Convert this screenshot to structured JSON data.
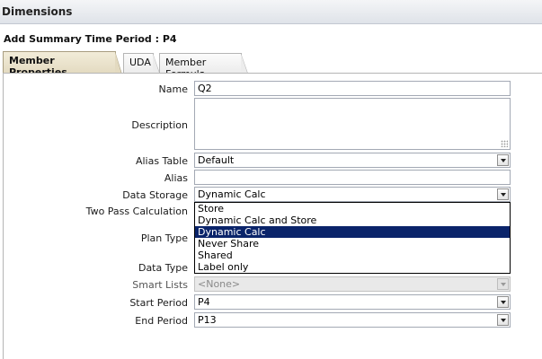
{
  "window": {
    "title": "Dimensions"
  },
  "page": {
    "subtitle": "Add Summary Time Period : P4"
  },
  "tabs": [
    {
      "label": "Member Properties",
      "active": true
    },
    {
      "label": "UDA",
      "active": false
    },
    {
      "label": "Member Formula",
      "active": false
    }
  ],
  "form": {
    "name_label": "Name",
    "name_value": "Q2",
    "description_label": "Description",
    "description_value": "",
    "alias_table_label": "Alias Table",
    "alias_table_value": "Default",
    "alias_label": "Alias",
    "alias_value": "",
    "data_storage_label": "Data Storage",
    "data_storage_value": "Dynamic Calc",
    "two_pass_label": "Two Pass Calculation",
    "plan_type_label": "Plan Type",
    "data_type_label": "Data Type",
    "smart_lists_label": "Smart Lists",
    "smart_lists_value": "<None>",
    "start_period_label": "Start Period",
    "start_period_value": "P4",
    "end_period_label": "End Period",
    "end_period_value": "P13"
  },
  "data_storage_options": [
    {
      "label": "Store",
      "selected": false
    },
    {
      "label": "Dynamic Calc and Store",
      "selected": false
    },
    {
      "label": "Dynamic Calc",
      "selected": true
    },
    {
      "label": "Never Share",
      "selected": false
    },
    {
      "label": "Shared",
      "selected": false
    },
    {
      "label": "Label only",
      "selected": false
    }
  ],
  "colors": {
    "selection_bg": "#0a246a",
    "active_tab_bg": "#e3dac0",
    "field_border": "#a3a9b4"
  }
}
